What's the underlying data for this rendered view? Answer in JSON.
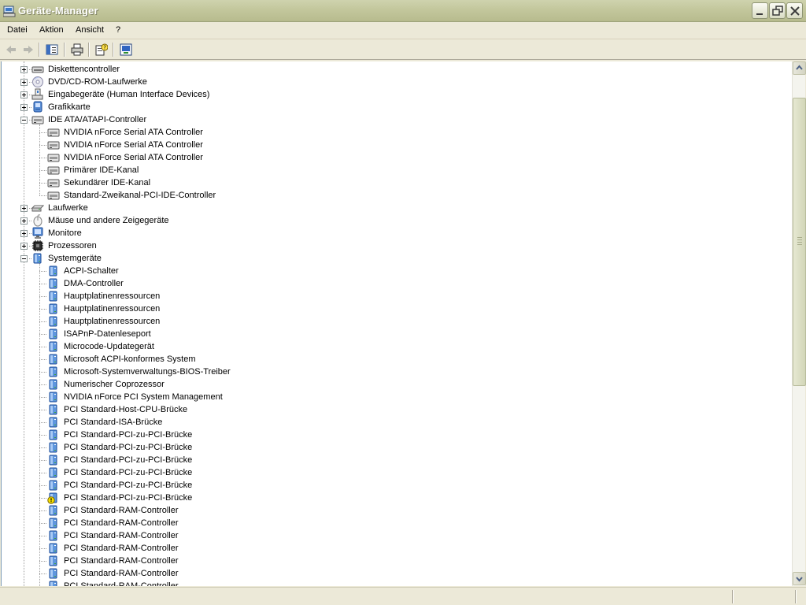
{
  "window": {
    "title": "Geräte-Manager"
  },
  "menu": {
    "items": [
      "Datei",
      "Aktion",
      "Ansicht",
      "?"
    ]
  },
  "colors": {
    "titlebar": "#C3C79C",
    "tree_background": "#FFFFFF",
    "warning": "#F7E100"
  },
  "toolbar": {
    "icons": [
      "back-arrow-icon",
      "forward-arrow-icon",
      "console-tree-icon",
      "printer-icon",
      "help-icon",
      "properties-icon"
    ]
  },
  "tree": {
    "nodes": [
      {
        "label": "Diskettencontroller",
        "level": 0,
        "expander": "plus",
        "icon": "floppy-controller-icon"
      },
      {
        "label": "DVD/CD-ROM-Laufwerke",
        "level": 0,
        "expander": "plus",
        "icon": "cdrom-icon"
      },
      {
        "label": "Eingabegeräte (Human Interface Devices)",
        "level": 0,
        "expander": "plus",
        "icon": "hid-icon"
      },
      {
        "label": "Grafikkarte",
        "level": 0,
        "expander": "plus",
        "icon": "display-adapter-icon"
      },
      {
        "label": "IDE ATA/ATAPI-Controller",
        "level": 0,
        "expander": "minus",
        "icon": "ide-controller-icon"
      },
      {
        "label": "NVIDIA nForce Serial ATA Controller",
        "level": 1,
        "icon": "ide-controller-icon"
      },
      {
        "label": "NVIDIA nForce Serial ATA Controller",
        "level": 1,
        "icon": "ide-controller-icon"
      },
      {
        "label": "NVIDIA nForce Serial ATA Controller",
        "level": 1,
        "icon": "ide-controller-icon"
      },
      {
        "label": "Primärer IDE-Kanal",
        "level": 1,
        "icon": "ide-controller-icon"
      },
      {
        "label": "Sekundärer IDE-Kanal",
        "level": 1,
        "icon": "ide-controller-icon"
      },
      {
        "label": "Standard-Zweikanal-PCI-IDE-Controller",
        "level": 1,
        "icon": "ide-controller-icon"
      },
      {
        "label": "Laufwerke",
        "level": 0,
        "expander": "plus",
        "icon": "disk-drive-icon"
      },
      {
        "label": "Mäuse und andere Zeigegeräte",
        "level": 0,
        "expander": "plus",
        "icon": "mouse-icon"
      },
      {
        "label": "Monitore",
        "level": 0,
        "expander": "plus",
        "icon": "monitor-icon"
      },
      {
        "label": "Prozessoren",
        "level": 0,
        "expander": "plus",
        "icon": "processor-icon"
      },
      {
        "label": "Systemgeräte",
        "level": 0,
        "expander": "minus",
        "icon": "system-device-icon"
      },
      {
        "label": "ACPI-Schalter",
        "level": 1,
        "icon": "system-device-icon"
      },
      {
        "label": "DMA-Controller",
        "level": 1,
        "icon": "system-device-icon"
      },
      {
        "label": "Hauptplatinenressourcen",
        "level": 1,
        "icon": "system-device-icon"
      },
      {
        "label": "Hauptplatinenressourcen",
        "level": 1,
        "icon": "system-device-icon"
      },
      {
        "label": "Hauptplatinenressourcen",
        "level": 1,
        "icon": "system-device-icon"
      },
      {
        "label": "ISAPnP-Datenleseport",
        "level": 1,
        "icon": "system-device-icon"
      },
      {
        "label": "Microcode-Updategerät",
        "level": 1,
        "icon": "system-device-icon"
      },
      {
        "label": "Microsoft ACPI-konformes System",
        "level": 1,
        "icon": "system-device-icon"
      },
      {
        "label": "Microsoft-Systemverwaltungs-BIOS-Treiber",
        "level": 1,
        "icon": "system-device-icon"
      },
      {
        "label": "Numerischer Coprozessor",
        "level": 1,
        "icon": "system-device-icon"
      },
      {
        "label": "NVIDIA nForce PCI System Management",
        "level": 1,
        "icon": "system-device-icon"
      },
      {
        "label": "PCI Standard-Host-CPU-Brücke",
        "level": 1,
        "icon": "system-device-icon"
      },
      {
        "label": "PCI Standard-ISA-Brücke",
        "level": 1,
        "icon": "system-device-icon"
      },
      {
        "label": "PCI Standard-PCI-zu-PCI-Brücke",
        "level": 1,
        "icon": "system-device-icon"
      },
      {
        "label": "PCI Standard-PCI-zu-PCI-Brücke",
        "level": 1,
        "icon": "system-device-icon"
      },
      {
        "label": "PCI Standard-PCI-zu-PCI-Brücke",
        "level": 1,
        "icon": "system-device-icon"
      },
      {
        "label": "PCI Standard-PCI-zu-PCI-Brücke",
        "level": 1,
        "icon": "system-device-icon"
      },
      {
        "label": "PCI Standard-PCI-zu-PCI-Brücke",
        "level": 1,
        "icon": "system-device-icon"
      },
      {
        "label": "PCI Standard-PCI-zu-PCI-Brücke",
        "level": 1,
        "icon": "system-device-warning-icon"
      },
      {
        "label": "PCI Standard-RAM-Controller",
        "level": 1,
        "icon": "system-device-icon"
      },
      {
        "label": "PCI Standard-RAM-Controller",
        "level": 1,
        "icon": "system-device-icon"
      },
      {
        "label": "PCI Standard-RAM-Controller",
        "level": 1,
        "icon": "system-device-icon"
      },
      {
        "label": "PCI Standard-RAM-Controller",
        "level": 1,
        "icon": "system-device-icon"
      },
      {
        "label": "PCI Standard-RAM-Controller",
        "level": 1,
        "icon": "system-device-icon"
      },
      {
        "label": "PCI Standard-RAM-Controller",
        "level": 1,
        "icon": "system-device-icon"
      },
      {
        "label": "PCI Standard-RAM-Controller",
        "level": 1,
        "icon": "system-device-icon"
      }
    ]
  }
}
